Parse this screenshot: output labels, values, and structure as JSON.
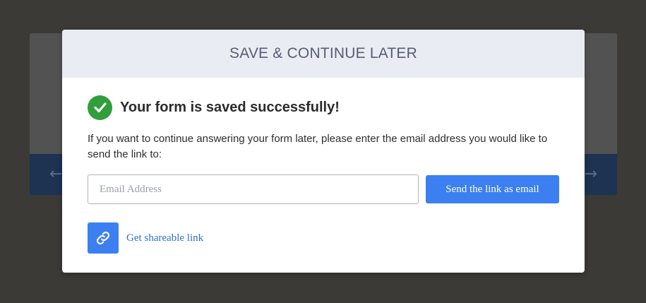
{
  "backdrop": {
    "prev_arrow_icon": "arrow-left-icon",
    "next_arrow_icon": "arrow-right-icon"
  },
  "modal": {
    "title": "SAVE & CONTINUE LATER",
    "success": {
      "icon": "check-circle-icon",
      "message": "Your form is saved successfully!"
    },
    "description": "If you want to continue answering your form later, please enter the email address you would like to send the link to:",
    "email": {
      "placeholder": "Email Address",
      "value": ""
    },
    "send_button_label": "Send the link as email",
    "share": {
      "icon": "link-icon",
      "label": "Get shareable link"
    }
  },
  "colors": {
    "accent": "#3c7ff0",
    "success": "#2f9e3b",
    "header_bg": "#eaecf4",
    "overlay": "#3c3a37",
    "link": "#2d6fcf"
  }
}
